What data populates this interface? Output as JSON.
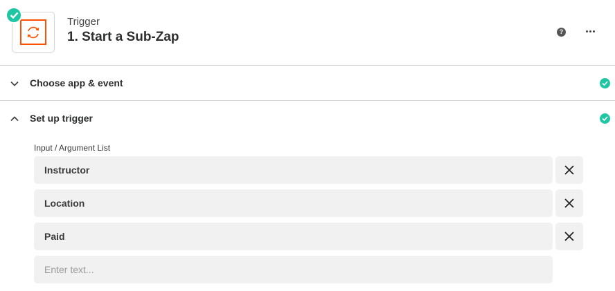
{
  "header": {
    "step_kind": "Trigger",
    "step_title": "1. Start a Sub-Zap",
    "help_symbol": "?",
    "app_icon": "refresh-cycle-icon",
    "status_icon": "check-icon",
    "accent_color": "#ff4f00",
    "success_color": "#1fc6a4"
  },
  "sections": [
    {
      "label": "Choose app & event",
      "expanded": false,
      "complete": true
    },
    {
      "label": "Set up trigger",
      "expanded": true,
      "complete": true
    }
  ],
  "argument_list": {
    "label": "Input / Argument List",
    "items": [
      "Instructor",
      "Location",
      "Paid"
    ],
    "new_item_placeholder": "Enter text..."
  }
}
